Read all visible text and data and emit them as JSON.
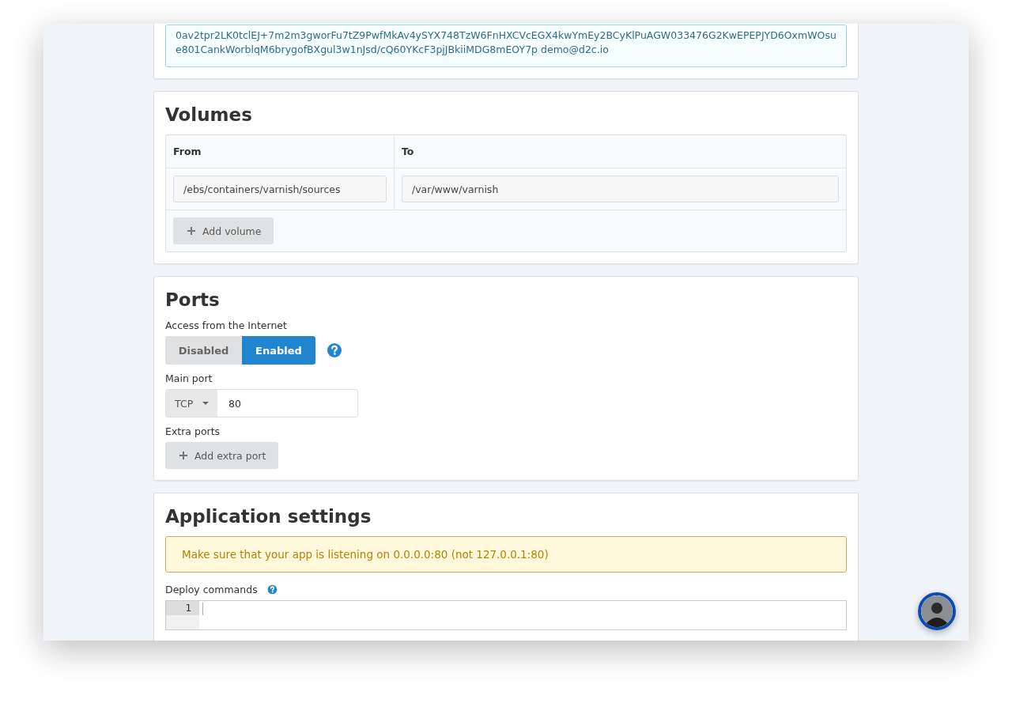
{
  "key_panel": {
    "lines": [
      "0av2tpr2LK0tclEJ+7m2m3gworFu7tZ9PwfMkAv4ySYX748TzW6FnHXCVcEGX4kwYmEy2BCyKlPuAGW033476G2KwEPEPJYD6OxmWOsu",
      "e801CankWorblqM6brygofBXgul3w1nJsd/cQ60YKcF3pjJBkiiMDG8mEOY7p demo@d2c.io"
    ]
  },
  "volumes": {
    "title": "Volumes",
    "columns": [
      "From",
      "To"
    ],
    "rows": [
      {
        "from": "/ebs/containers/varnish/sources",
        "to": "/var/www/varnish"
      }
    ],
    "add_button": "Add volume"
  },
  "ports": {
    "title": "Ports",
    "access_label": "Access from the Internet",
    "access_options": [
      {
        "label": "Disabled",
        "selected": false
      },
      {
        "label": "Enabled",
        "selected": true
      }
    ],
    "main_port_label": "Main port",
    "protocol": "TCP",
    "port": "80",
    "extra_ports_label": "Extra ports",
    "add_button": "Add extra port"
  },
  "app_settings": {
    "title": "Application settings",
    "notice": "Make sure that your app is listening on 0.0.0.0:80 (not 127.0.0.1:80)",
    "deploy_label": "Deploy commands",
    "line_numbers": [
      "1"
    ]
  }
}
